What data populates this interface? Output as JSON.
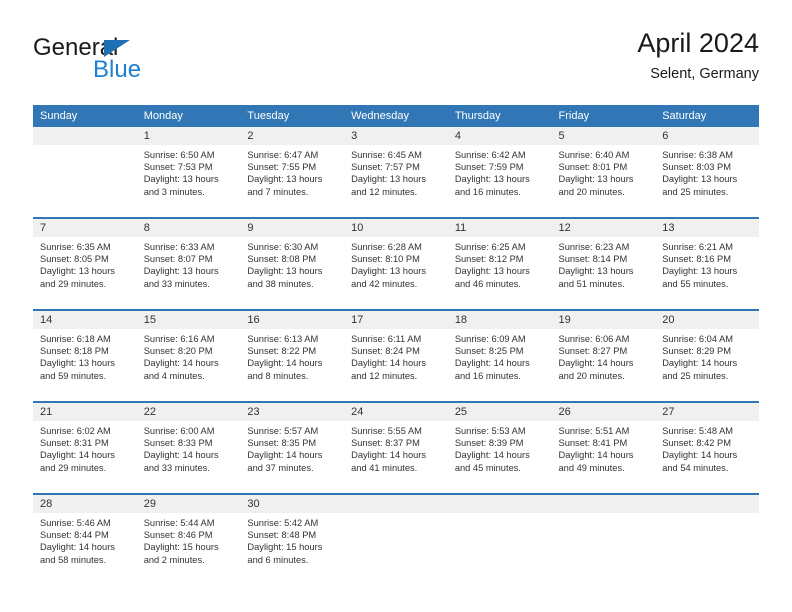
{
  "brand": {
    "name_part1": "General",
    "name_part2": "Blue",
    "triangle_icon": "triangle-icon",
    "accent_color": "#1f7fd4"
  },
  "header": {
    "title": "April 2024",
    "subtitle": "Selent, Germany"
  },
  "colors": {
    "header_row_bg": "#3277b5",
    "daynum_bg": "#f0f0f0",
    "row_divider": "#3277b5",
    "text": "#333333"
  },
  "calendar": {
    "weekday_headers": [
      "Sunday",
      "Monday",
      "Tuesday",
      "Wednesday",
      "Thursday",
      "Friday",
      "Saturday"
    ],
    "weeks": [
      [
        {
          "day": "",
          "sunrise": "",
          "sunset": "",
          "daylight_line1": "",
          "daylight_line2": "",
          "empty": true
        },
        {
          "day": "1",
          "sunrise": "Sunrise: 6:50 AM",
          "sunset": "Sunset: 7:53 PM",
          "daylight_line1": "Daylight: 13 hours",
          "daylight_line2": "and 3 minutes.",
          "empty": false
        },
        {
          "day": "2",
          "sunrise": "Sunrise: 6:47 AM",
          "sunset": "Sunset: 7:55 PM",
          "daylight_line1": "Daylight: 13 hours",
          "daylight_line2": "and 7 minutes.",
          "empty": false
        },
        {
          "day": "3",
          "sunrise": "Sunrise: 6:45 AM",
          "sunset": "Sunset: 7:57 PM",
          "daylight_line1": "Daylight: 13 hours",
          "daylight_line2": "and 12 minutes.",
          "empty": false
        },
        {
          "day": "4",
          "sunrise": "Sunrise: 6:42 AM",
          "sunset": "Sunset: 7:59 PM",
          "daylight_line1": "Daylight: 13 hours",
          "daylight_line2": "and 16 minutes.",
          "empty": false
        },
        {
          "day": "5",
          "sunrise": "Sunrise: 6:40 AM",
          "sunset": "Sunset: 8:01 PM",
          "daylight_line1": "Daylight: 13 hours",
          "daylight_line2": "and 20 minutes.",
          "empty": false
        },
        {
          "day": "6",
          "sunrise": "Sunrise: 6:38 AM",
          "sunset": "Sunset: 8:03 PM",
          "daylight_line1": "Daylight: 13 hours",
          "daylight_line2": "and 25 minutes.",
          "empty": false
        }
      ],
      [
        {
          "day": "7",
          "sunrise": "Sunrise: 6:35 AM",
          "sunset": "Sunset: 8:05 PM",
          "daylight_line1": "Daylight: 13 hours",
          "daylight_line2": "and 29 minutes.",
          "empty": false
        },
        {
          "day": "8",
          "sunrise": "Sunrise: 6:33 AM",
          "sunset": "Sunset: 8:07 PM",
          "daylight_line1": "Daylight: 13 hours",
          "daylight_line2": "and 33 minutes.",
          "empty": false
        },
        {
          "day": "9",
          "sunrise": "Sunrise: 6:30 AM",
          "sunset": "Sunset: 8:08 PM",
          "daylight_line1": "Daylight: 13 hours",
          "daylight_line2": "and 38 minutes.",
          "empty": false
        },
        {
          "day": "10",
          "sunrise": "Sunrise: 6:28 AM",
          "sunset": "Sunset: 8:10 PM",
          "daylight_line1": "Daylight: 13 hours",
          "daylight_line2": "and 42 minutes.",
          "empty": false
        },
        {
          "day": "11",
          "sunrise": "Sunrise: 6:25 AM",
          "sunset": "Sunset: 8:12 PM",
          "daylight_line1": "Daylight: 13 hours",
          "daylight_line2": "and 46 minutes.",
          "empty": false
        },
        {
          "day": "12",
          "sunrise": "Sunrise: 6:23 AM",
          "sunset": "Sunset: 8:14 PM",
          "daylight_line1": "Daylight: 13 hours",
          "daylight_line2": "and 51 minutes.",
          "empty": false
        },
        {
          "day": "13",
          "sunrise": "Sunrise: 6:21 AM",
          "sunset": "Sunset: 8:16 PM",
          "daylight_line1": "Daylight: 13 hours",
          "daylight_line2": "and 55 minutes.",
          "empty": false
        }
      ],
      [
        {
          "day": "14",
          "sunrise": "Sunrise: 6:18 AM",
          "sunset": "Sunset: 8:18 PM",
          "daylight_line1": "Daylight: 13 hours",
          "daylight_line2": "and 59 minutes.",
          "empty": false
        },
        {
          "day": "15",
          "sunrise": "Sunrise: 6:16 AM",
          "sunset": "Sunset: 8:20 PM",
          "daylight_line1": "Daylight: 14 hours",
          "daylight_line2": "and 4 minutes.",
          "empty": false
        },
        {
          "day": "16",
          "sunrise": "Sunrise: 6:13 AM",
          "sunset": "Sunset: 8:22 PM",
          "daylight_line1": "Daylight: 14 hours",
          "daylight_line2": "and 8 minutes.",
          "empty": false
        },
        {
          "day": "17",
          "sunrise": "Sunrise: 6:11 AM",
          "sunset": "Sunset: 8:24 PM",
          "daylight_line1": "Daylight: 14 hours",
          "daylight_line2": "and 12 minutes.",
          "empty": false
        },
        {
          "day": "18",
          "sunrise": "Sunrise: 6:09 AM",
          "sunset": "Sunset: 8:25 PM",
          "daylight_line1": "Daylight: 14 hours",
          "daylight_line2": "and 16 minutes.",
          "empty": false
        },
        {
          "day": "19",
          "sunrise": "Sunrise: 6:06 AM",
          "sunset": "Sunset: 8:27 PM",
          "daylight_line1": "Daylight: 14 hours",
          "daylight_line2": "and 20 minutes.",
          "empty": false
        },
        {
          "day": "20",
          "sunrise": "Sunrise: 6:04 AM",
          "sunset": "Sunset: 8:29 PM",
          "daylight_line1": "Daylight: 14 hours",
          "daylight_line2": "and 25 minutes.",
          "empty": false
        }
      ],
      [
        {
          "day": "21",
          "sunrise": "Sunrise: 6:02 AM",
          "sunset": "Sunset: 8:31 PM",
          "daylight_line1": "Daylight: 14 hours",
          "daylight_line2": "and 29 minutes.",
          "empty": false
        },
        {
          "day": "22",
          "sunrise": "Sunrise: 6:00 AM",
          "sunset": "Sunset: 8:33 PM",
          "daylight_line1": "Daylight: 14 hours",
          "daylight_line2": "and 33 minutes.",
          "empty": false
        },
        {
          "day": "23",
          "sunrise": "Sunrise: 5:57 AM",
          "sunset": "Sunset: 8:35 PM",
          "daylight_line1": "Daylight: 14 hours",
          "daylight_line2": "and 37 minutes.",
          "empty": false
        },
        {
          "day": "24",
          "sunrise": "Sunrise: 5:55 AM",
          "sunset": "Sunset: 8:37 PM",
          "daylight_line1": "Daylight: 14 hours",
          "daylight_line2": "and 41 minutes.",
          "empty": false
        },
        {
          "day": "25",
          "sunrise": "Sunrise: 5:53 AM",
          "sunset": "Sunset: 8:39 PM",
          "daylight_line1": "Daylight: 14 hours",
          "daylight_line2": "and 45 minutes.",
          "empty": false
        },
        {
          "day": "26",
          "sunrise": "Sunrise: 5:51 AM",
          "sunset": "Sunset: 8:41 PM",
          "daylight_line1": "Daylight: 14 hours",
          "daylight_line2": "and 49 minutes.",
          "empty": false
        },
        {
          "day": "27",
          "sunrise": "Sunrise: 5:48 AM",
          "sunset": "Sunset: 8:42 PM",
          "daylight_line1": "Daylight: 14 hours",
          "daylight_line2": "and 54 minutes.",
          "empty": false
        }
      ],
      [
        {
          "day": "28",
          "sunrise": "Sunrise: 5:46 AM",
          "sunset": "Sunset: 8:44 PM",
          "daylight_line1": "Daylight: 14 hours",
          "daylight_line2": "and 58 minutes.",
          "empty": false
        },
        {
          "day": "29",
          "sunrise": "Sunrise: 5:44 AM",
          "sunset": "Sunset: 8:46 PM",
          "daylight_line1": "Daylight: 15 hours",
          "daylight_line2": "and 2 minutes.",
          "empty": false
        },
        {
          "day": "30",
          "sunrise": "Sunrise: 5:42 AM",
          "sunset": "Sunset: 8:48 PM",
          "daylight_line1": "Daylight: 15 hours",
          "daylight_line2": "and 6 minutes.",
          "empty": false
        },
        {
          "day": "",
          "sunrise": "",
          "sunset": "",
          "daylight_line1": "",
          "daylight_line2": "",
          "empty": true
        },
        {
          "day": "",
          "sunrise": "",
          "sunset": "",
          "daylight_line1": "",
          "daylight_line2": "",
          "empty": true
        },
        {
          "day": "",
          "sunrise": "",
          "sunset": "",
          "daylight_line1": "",
          "daylight_line2": "",
          "empty": true
        },
        {
          "day": "",
          "sunrise": "",
          "sunset": "",
          "daylight_line1": "",
          "daylight_line2": "",
          "empty": true
        }
      ]
    ]
  }
}
